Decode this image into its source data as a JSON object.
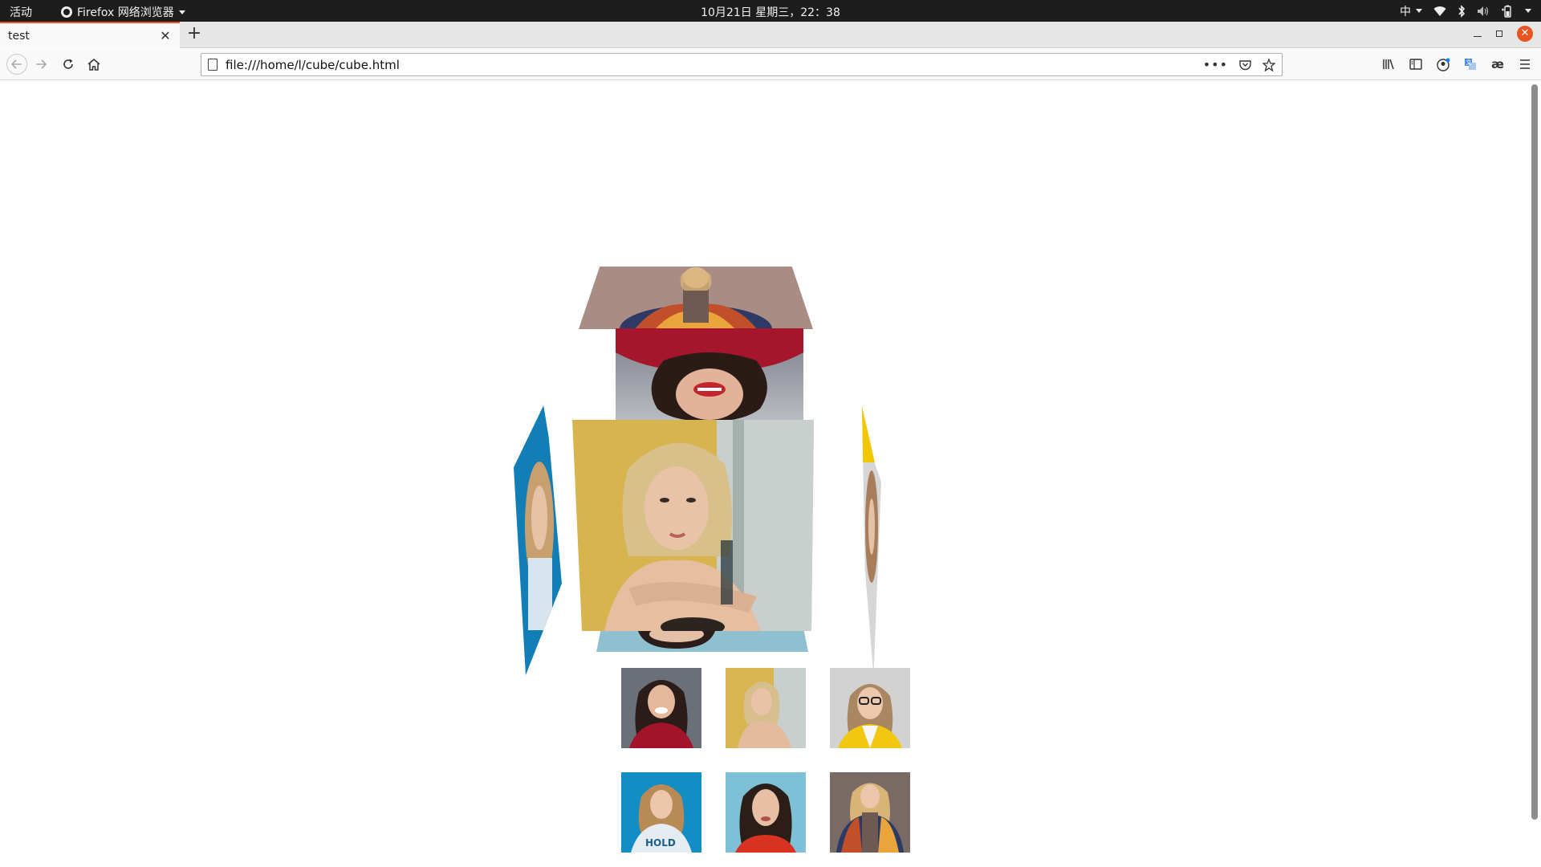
{
  "system_bar": {
    "activities": "活动",
    "app_menu": "Firefox 网络浏览器",
    "clock": "10月21日 星期三，22：38",
    "input_method": "中"
  },
  "browser": {
    "tab_title": "test",
    "url": "file:///home/l/cube/cube.html"
  },
  "colors": {
    "accent": "#e95420",
    "topbar_bg": "#1d1d1d",
    "toolbar_bg": "#f9f9fa"
  },
  "cube": {
    "faces": [
      {
        "name": "top",
        "photo": "woman-patterned-jacket",
        "bg": "#9a7c72"
      },
      {
        "name": "back",
        "photo": "woman-red-lips",
        "bg": "#8e1e2e"
      },
      {
        "name": "front",
        "photo": "blonde-woman-yellow-wall",
        "bg": "#d8b54a"
      },
      {
        "name": "left",
        "photo": "woman-blue-background",
        "bg": "#1b86b8"
      },
      {
        "name": "right",
        "photo": "woman-yellow-cardigan",
        "bg": "#cfcfcf"
      },
      {
        "name": "bottom",
        "photo": "woman-light-blue",
        "bg": "#8ec0d0"
      }
    ]
  },
  "thumbnails": [
    {
      "photo": "woman-red-sweater",
      "bg": "#9e1b2c"
    },
    {
      "photo": "blonde-woman-yellow-wall",
      "bg": "#d9b450"
    },
    {
      "photo": "woman-glasses-yellow",
      "bg": "#cfcfcf"
    },
    {
      "photo": "woman-blue-top",
      "bg": "#138ec5"
    },
    {
      "photo": "woman-red-top-blue-bg",
      "bg": "#7ec0d6"
    },
    {
      "photo": "woman-patterned-jacket",
      "bg": "#7a6a66"
    }
  ]
}
